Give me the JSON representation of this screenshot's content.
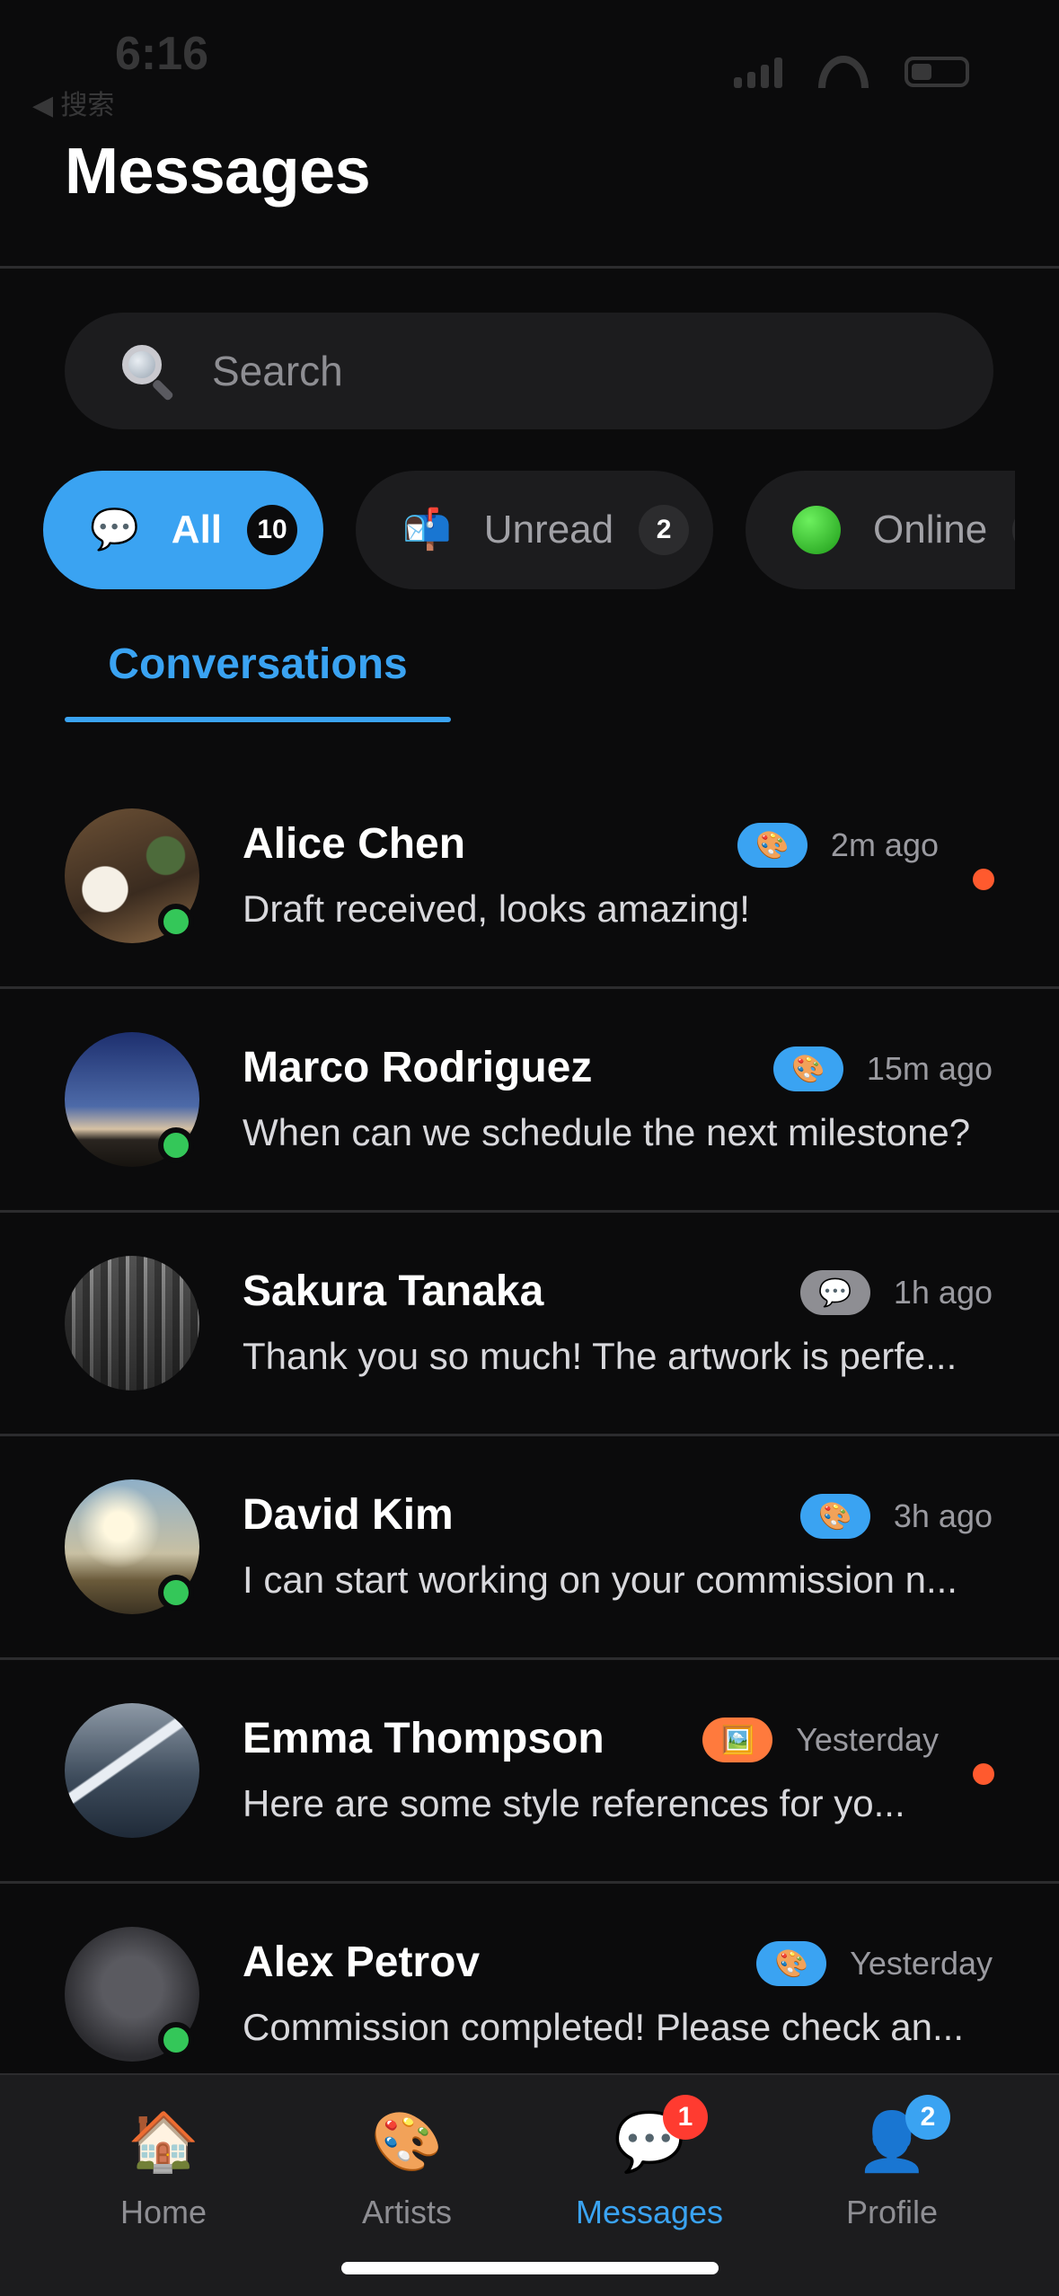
{
  "status_bar": {
    "time": "6:16",
    "back_label": "◀ 搜索"
  },
  "header": {
    "title": "Messages"
  },
  "search": {
    "placeholder": "Search"
  },
  "filters": [
    {
      "icon": "💬",
      "label": "All",
      "count": "10",
      "active": true
    },
    {
      "icon": "📬",
      "label": "Unread",
      "count": "2",
      "active": false
    },
    {
      "icon": "online-dot",
      "label": "Online",
      "count": "",
      "active": false
    }
  ],
  "tabs": {
    "active_label": "Conversations"
  },
  "conversations": [
    {
      "name": "Alice Chen",
      "preview": "Draft received, looks amazing!",
      "time": "2m ago",
      "tag_icon": "🎨",
      "tag_color": "#3aa3f2",
      "online": true,
      "unread": true
    },
    {
      "name": "Marco Rodriguez",
      "preview": "When can we schedule the next milestone?",
      "time": "15m ago",
      "tag_icon": "🎨",
      "tag_color": "#3aa3f2",
      "online": true,
      "unread": false
    },
    {
      "name": "Sakura Tanaka",
      "preview": "Thank you so much! The artwork is perfe...",
      "time": "1h ago",
      "tag_icon": "💬",
      "tag_color": "#8e8e93",
      "online": false,
      "unread": false
    },
    {
      "name": "David Kim",
      "preview": "I can start working on your commission n...",
      "time": "3h ago",
      "tag_icon": "🎨",
      "tag_color": "#3aa3f2",
      "online": true,
      "unread": false
    },
    {
      "name": "Emma Thompson",
      "preview": "Here are some style references for yo...",
      "time": "Yesterday",
      "tag_icon": "🖼️",
      "tag_color": "#ff7a3d",
      "online": false,
      "unread": true
    },
    {
      "name": "Alex Petrov",
      "preview": "Commission completed! Please check an...",
      "time": "Yesterday",
      "tag_icon": "🎨",
      "tag_color": "#3aa3f2",
      "online": true,
      "unread": false
    }
  ],
  "tabbar": {
    "items": [
      {
        "icon": "🏠",
        "label": "Home",
        "badge": ""
      },
      {
        "icon": "🎨",
        "label": "Artists",
        "badge": ""
      },
      {
        "icon": "💬",
        "label": "Messages",
        "badge": "1"
      },
      {
        "icon": "👤",
        "label": "Profile",
        "badge": "2"
      }
    ]
  },
  "colors": {
    "accent": "#3aa3f2",
    "background": "#0b0b0c",
    "online": "#34c759",
    "unread": "#ff5a2e"
  }
}
